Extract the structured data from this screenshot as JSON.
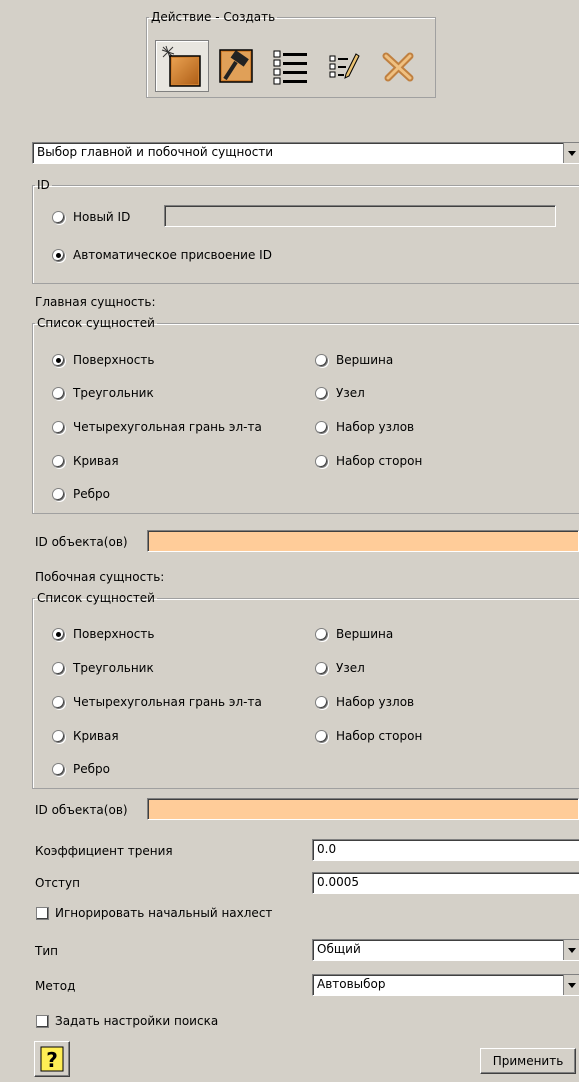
{
  "action_group": {
    "legend": "Действие - Создать",
    "tools": [
      {
        "icon": "create-icon",
        "pressed": true
      },
      {
        "icon": "modify-icon",
        "pressed": false
      },
      {
        "icon": "list-icon",
        "pressed": false
      },
      {
        "icon": "edit-icon",
        "pressed": false
      },
      {
        "icon": "delete-icon",
        "pressed": false
      }
    ]
  },
  "selection_mode": {
    "value": "Выбор главной и побочной сущности"
  },
  "id_group": {
    "legend": "ID",
    "new_id_label": "Новый ID",
    "new_id_value": "",
    "auto_id_label": "Автоматическое присвоение ID",
    "selected": "auto"
  },
  "main_entity": {
    "heading": "Главная сущность:",
    "list_legend": "Список сущностей",
    "options_left": [
      "Поверхность",
      "Треугольник",
      "Четырехугольная грань эл-та",
      "Кривая",
      "Ребро"
    ],
    "options_right": [
      "Вершина",
      "Узел",
      "Набор узлов",
      "Набор сторон"
    ],
    "selected": "Поверхность",
    "object_ids_label": "ID объекта(ов)",
    "object_ids_value": ""
  },
  "secondary_entity": {
    "heading": "Побочная сущность:",
    "list_legend": "Список сущностей",
    "options_left": [
      "Поверхность",
      "Треугольник",
      "Четырехугольная грань эл-та",
      "Кривая",
      "Ребро"
    ],
    "options_right": [
      "Вершина",
      "Узел",
      "Набор узлов",
      "Набор сторон"
    ],
    "selected": "Поверхность",
    "object_ids_label": "ID объекта(ов)",
    "object_ids_value": ""
  },
  "params": {
    "friction_label": "Коэффициент трения",
    "friction_value": "0.0",
    "offset_label": "Отступ",
    "offset_value": "0.0005",
    "ignore_overlap_label": "Игнорировать начальный нахлест",
    "ignore_overlap_checked": false,
    "type_label": "Тип",
    "type_value": "Общий",
    "method_label": "Метод",
    "method_value": "Автовыбор",
    "search_settings_label": "Задать настройки поиска",
    "search_settings_checked": false
  },
  "footer": {
    "help_icon": "help-icon",
    "apply_label": "Применить"
  },
  "colors": {
    "panel": "#d4d0c8",
    "highlight_field": "#ffcc99"
  }
}
